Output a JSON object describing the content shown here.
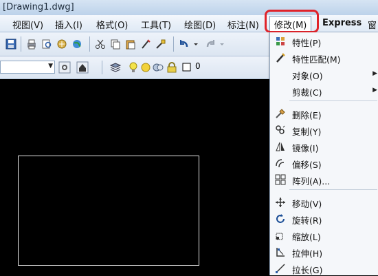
{
  "window": {
    "title": "[Drawing1.dwg]"
  },
  "menubar": {
    "items": [
      {
        "label": "视图(V)"
      },
      {
        "label": "插入(I)"
      },
      {
        "label": "格式(O)"
      },
      {
        "label": "工具(T)"
      },
      {
        "label": "绘图(D)"
      },
      {
        "label": "标注(N)"
      },
      {
        "label": "修改(M)"
      },
      {
        "label": "Express"
      },
      {
        "label": "窗"
      }
    ]
  },
  "toolbar": {
    "layer_value": "0"
  },
  "modify_menu": {
    "items": [
      {
        "label": "特性(P)",
        "icon": "properties-icon"
      },
      {
        "label": "特性匹配(M)",
        "icon": "match-properties-icon"
      },
      {
        "label": "对象(O)",
        "submenu": true
      },
      {
        "label": "剪裁(C)",
        "submenu": true
      },
      {
        "label": "删除(E)",
        "icon": "erase-icon"
      },
      {
        "label": "复制(Y)",
        "icon": "copy-icon"
      },
      {
        "label": "镜像(I)",
        "icon": "mirror-icon"
      },
      {
        "label": "偏移(S)",
        "icon": "offset-icon"
      },
      {
        "label": "阵列(A)...",
        "icon": "array-icon"
      },
      {
        "label": "移动(V)",
        "icon": "move-icon"
      },
      {
        "label": "旋转(R)",
        "icon": "rotate-icon"
      },
      {
        "label": "缩放(L)",
        "icon": "scale-icon"
      },
      {
        "label": "拉伸(H)",
        "icon": "stretch-icon"
      },
      {
        "label": "拉长(G)",
        "icon": "lengthen-icon"
      }
    ]
  },
  "colors": {
    "highlight_ring": "#e0232a",
    "canvas": "#000000",
    "shape_stroke": "#e8e8e8"
  }
}
